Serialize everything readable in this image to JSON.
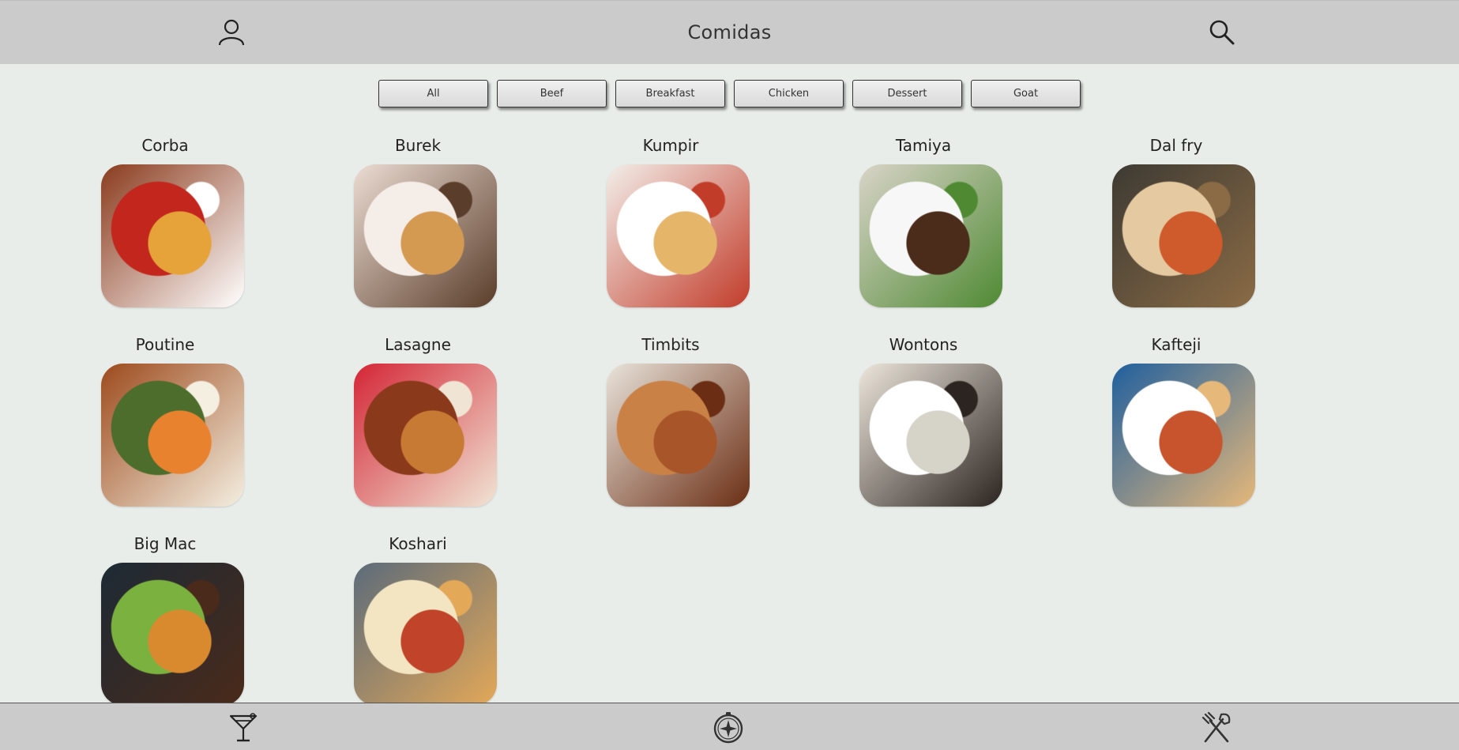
{
  "header": {
    "title": "Comidas",
    "profile_icon": "profile-icon",
    "search_icon": "search-icon"
  },
  "filters": [
    "All",
    "Beef",
    "Breakfast",
    "Chicken",
    "Dessert",
    "Goat"
  ],
  "meals": [
    {
      "name": "Corba",
      "palette": [
        "#8a3b1d",
        "#e6a33a",
        "#ffffff",
        "#c3261d"
      ]
    },
    {
      "name": "Burek",
      "palette": [
        "#ecdcd3",
        "#d49a52",
        "#5a3d2a",
        "#f5ede8"
      ]
    },
    {
      "name": "Kumpir",
      "palette": [
        "#f3eee9",
        "#e5b56a",
        "#c23c2a",
        "#ffffff"
      ]
    },
    {
      "name": "Tamiya",
      "palette": [
        "#d9d4c8",
        "#4b2b1a",
        "#4f8a33",
        "#f7f7f7"
      ]
    },
    {
      "name": "Dal fry",
      "palette": [
        "#3d3a33",
        "#cf5a2b",
        "#8a6b45",
        "#e4c9a1"
      ]
    },
    {
      "name": "Poutine",
      "palette": [
        "#9d4a1c",
        "#e9822e",
        "#f4efe1",
        "#4c6d2c"
      ]
    },
    {
      "name": "Lasagne",
      "palette": [
        "#d42535",
        "#c77a33",
        "#f0e5d4",
        "#8a3a1a"
      ]
    },
    {
      "name": "Timbits",
      "palette": [
        "#e9e3da",
        "#a8552a",
        "#6b2e14",
        "#c98146"
      ]
    },
    {
      "name": "Wontons",
      "palette": [
        "#ede6dc",
        "#d6d3c9",
        "#2b2420",
        "#ffffff"
      ]
    },
    {
      "name": "Kafteji",
      "palette": [
        "#1f5f9e",
        "#c7542d",
        "#e6b87a",
        "#ffffff"
      ]
    },
    {
      "name": "Big Mac",
      "palette": [
        "#1d2a35",
        "#d98a2f",
        "#4a2a1a",
        "#7bb13e"
      ]
    },
    {
      "name": "Koshari",
      "palette": [
        "#5b6b7a",
        "#c0432a",
        "#e3a858",
        "#f3e4c2"
      ]
    }
  ],
  "footer": {
    "drinks_icon": "drinks-icon",
    "explore_icon": "explore-icon",
    "meals_icon": "meals-icon"
  }
}
